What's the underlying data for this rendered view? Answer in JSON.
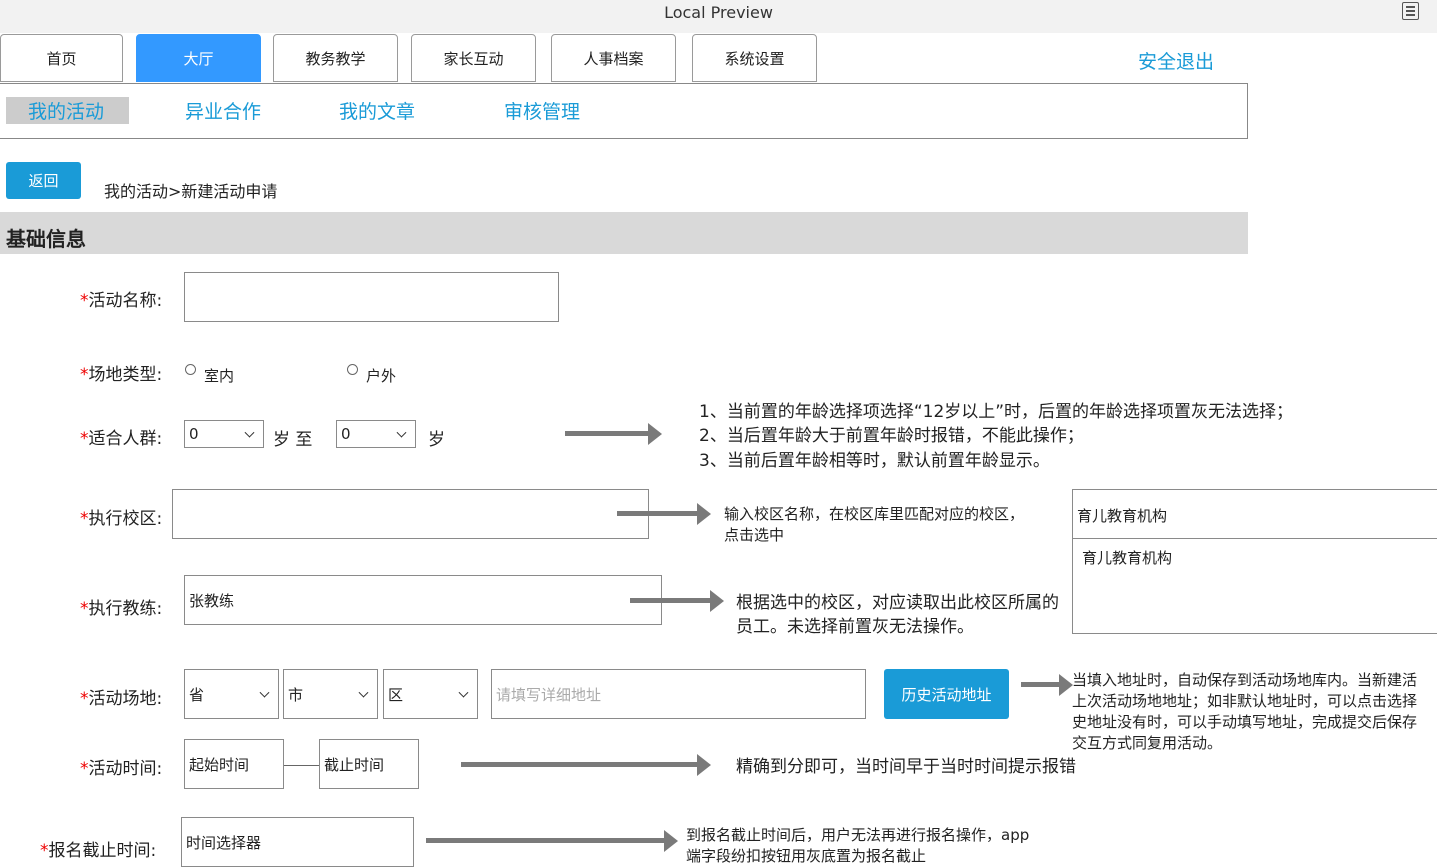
{
  "window": {
    "title": "Local Preview"
  },
  "nav": {
    "tabs": [
      {
        "label": "首页"
      },
      {
        "label": "大厅"
      },
      {
        "label": "教务教学"
      },
      {
        "label": "家长互动"
      },
      {
        "label": "人事档案"
      },
      {
        "label": "系统设置"
      }
    ],
    "active_tab": "大厅",
    "logout": "安全退出"
  },
  "subnav": {
    "items": [
      {
        "label": "我的活动"
      },
      {
        "label": "异业合作"
      },
      {
        "label": "我的文章"
      },
      {
        "label": "审核管理"
      }
    ],
    "active": "我的活动"
  },
  "back_button": "返回",
  "breadcrumb": "我的活动>新建活动申请",
  "section_title": "基础信息",
  "form": {
    "required_mark": "*",
    "activity_name": {
      "label": "活动名称:",
      "value": ""
    },
    "venue_type": {
      "label": "场地类型:",
      "options": [
        "室内",
        "户外"
      ]
    },
    "age": {
      "label": "适合人群:",
      "from": "0",
      "sep": "岁 至",
      "to": "0",
      "unit": "岁"
    },
    "campus": {
      "label": "执行校区:",
      "value": ""
    },
    "coach": {
      "label": "执行教练:",
      "value": "张教练"
    },
    "venue": {
      "label": "活动场地:",
      "province": "省",
      "city": "市",
      "district": "区",
      "address_placeholder": "请填写详细地址",
      "history_button": "历史活动地址"
    },
    "time": {
      "label": "活动时间:",
      "start": "起始时间",
      "end": "截止时间"
    },
    "deadline": {
      "label": "报名截止时间:",
      "value": "时间选择器"
    }
  },
  "notes": {
    "age": [
      "1、当前置的年龄选择项选择“12岁以上”时，后置的年龄选择项置灰无法选择；",
      "2、当后置年龄大于前置年龄时报错，不能此操作；",
      "3、当前后置年龄相等时，默认前置年龄显示。"
    ],
    "campus": [
      "输入校区名称，在校区库里匹配对应的校区，",
      "点击选中"
    ],
    "campus_dropdown": {
      "input": "育儿教育机构",
      "option": "育儿教育机构"
    },
    "coach": [
      "根据选中的校区，对应读取出此校区所属的",
      "员工。未选择前置灰无法操作。"
    ],
    "venue": [
      "当填入地址时，自动保存到活动场地库内。当新建活",
      "上次活动场地地址；如非默认地址时，可以点击选择",
      "史地址没有时，可以手动填写地址，完成提交后保存",
      "交互方式同复用活动。"
    ],
    "time": "精确到分即可，当时间早于当时时间提示报错",
    "deadline": [
      "到报名截止时间后，用户无法再进行报名操作，app",
      "端字段纷扣按钮用灰底置为报名截止"
    ]
  }
}
